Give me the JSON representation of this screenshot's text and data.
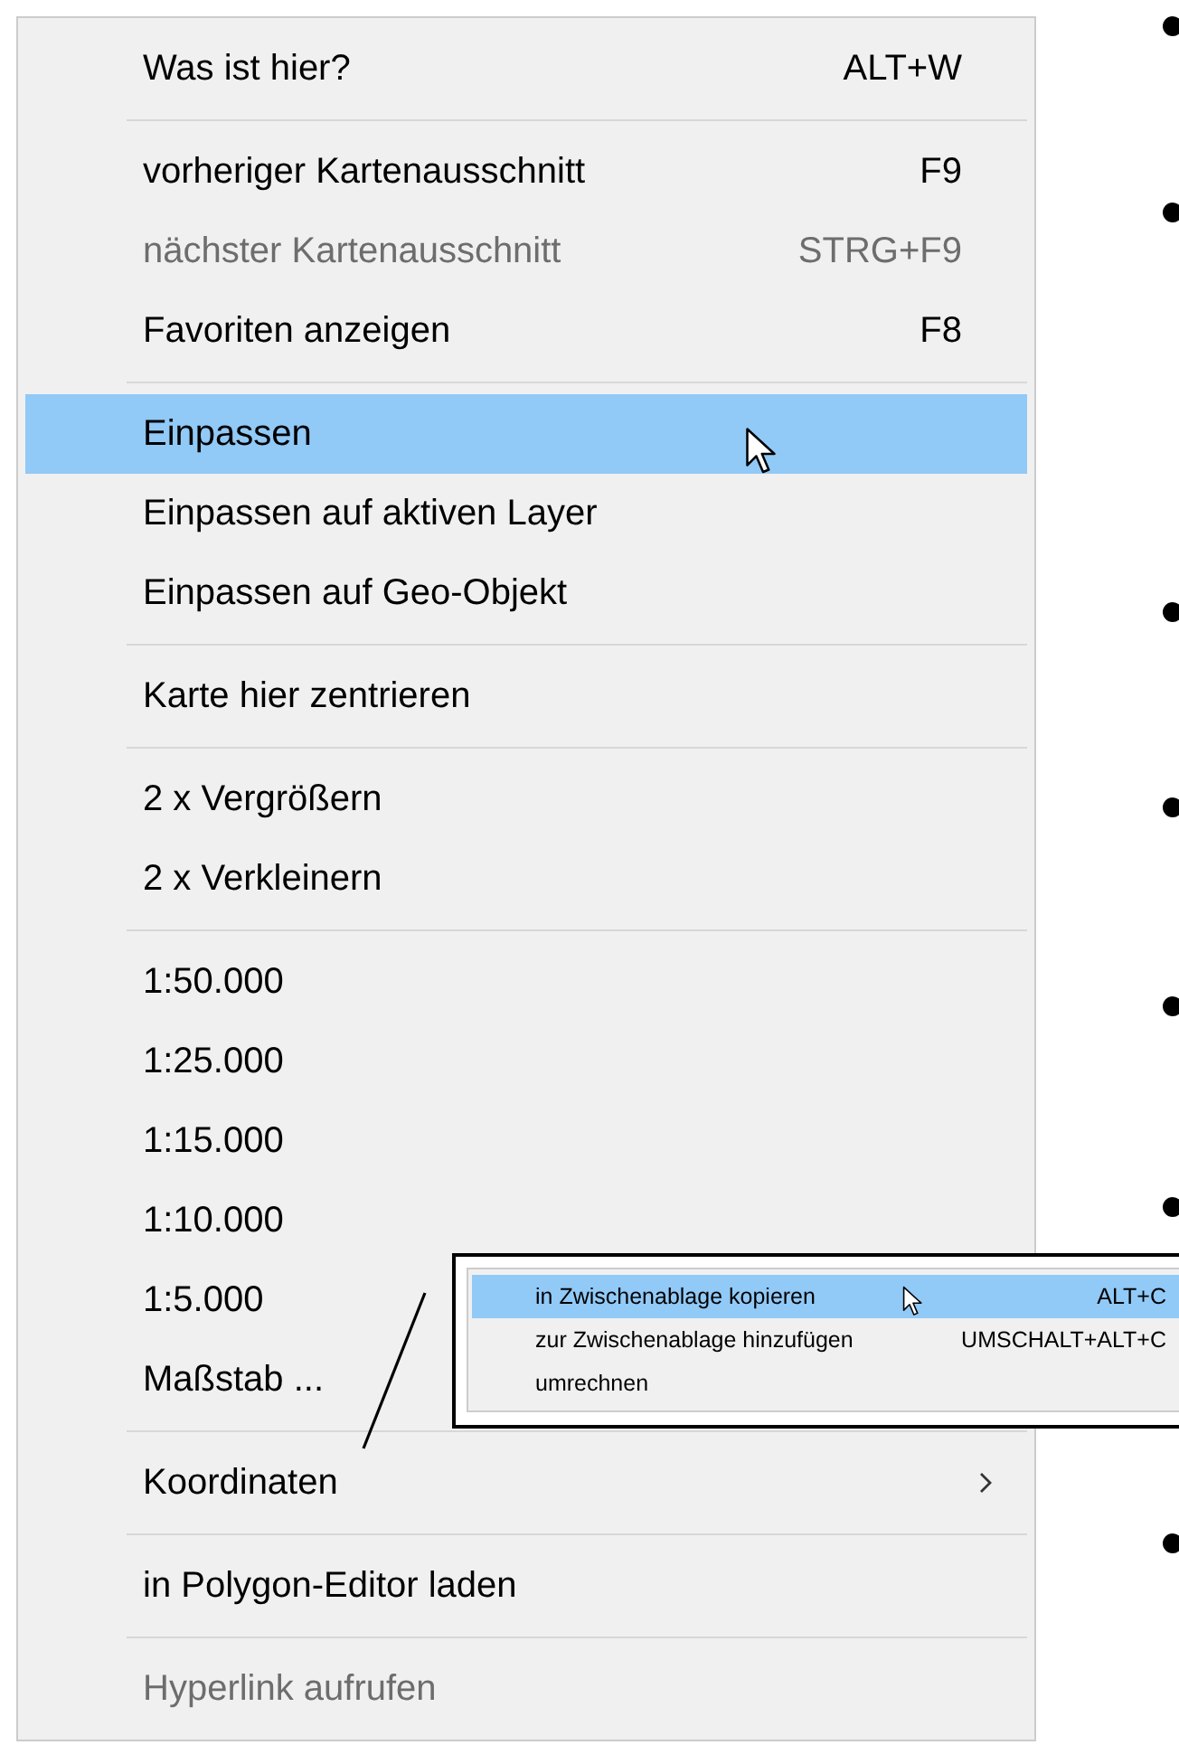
{
  "context_menu": {
    "items": [
      {
        "kind": "item",
        "label": "Was ist hier?",
        "shortcut": "ALT+W",
        "disabled": false,
        "selected": false
      },
      {
        "kind": "separator"
      },
      {
        "kind": "item",
        "label": "vorheriger Kartenausschnitt",
        "shortcut": "F9",
        "disabled": false,
        "selected": false
      },
      {
        "kind": "item",
        "label": "nächster Kartenausschnitt",
        "shortcut": "STRG+F9",
        "disabled": true,
        "selected": false
      },
      {
        "kind": "item",
        "label": "Favoriten anzeigen",
        "shortcut": "F8",
        "disabled": false,
        "selected": false
      },
      {
        "kind": "separator"
      },
      {
        "kind": "item",
        "label": "Einpassen",
        "disabled": false,
        "selected": true
      },
      {
        "kind": "item",
        "label": "Einpassen auf aktiven Layer",
        "disabled": false,
        "selected": false
      },
      {
        "kind": "item",
        "label": "Einpassen auf Geo-Objekt",
        "disabled": false,
        "selected": false
      },
      {
        "kind": "separator"
      },
      {
        "kind": "item",
        "label": "Karte hier zentrieren",
        "disabled": false,
        "selected": false
      },
      {
        "kind": "separator"
      },
      {
        "kind": "item",
        "label": "2 x Vergrößern",
        "disabled": false,
        "selected": false
      },
      {
        "kind": "item",
        "label": "2 x Verkleinern",
        "disabled": false,
        "selected": false
      },
      {
        "kind": "separator"
      },
      {
        "kind": "item",
        "label": "1:50.000",
        "disabled": false,
        "selected": false
      },
      {
        "kind": "item",
        "label": "1:25.000",
        "disabled": false,
        "selected": false
      },
      {
        "kind": "item",
        "label": "1:15.000",
        "disabled": false,
        "selected": false
      },
      {
        "kind": "item",
        "label": "1:10.000",
        "disabled": false,
        "selected": false
      },
      {
        "kind": "item",
        "label": "1:5.000",
        "disabled": false,
        "selected": false
      },
      {
        "kind": "item",
        "label": "Maßstab ...",
        "disabled": false,
        "selected": false
      },
      {
        "kind": "separator"
      },
      {
        "kind": "item",
        "label": "Koordinaten",
        "disabled": false,
        "selected": false,
        "submenu": true
      },
      {
        "kind": "separator"
      },
      {
        "kind": "item",
        "label": "in Polygon-Editor laden",
        "disabled": false,
        "selected": false
      },
      {
        "kind": "separator"
      },
      {
        "kind": "item",
        "label": "Hyperlink aufrufen",
        "disabled": true,
        "selected": false
      }
    ]
  },
  "submenu_callout": {
    "items": [
      {
        "label": "in Zwischenablage kopieren",
        "shortcut": "ALT+C",
        "selected": true
      },
      {
        "label": "zur Zwischenablage hinzufügen",
        "shortcut": "UMSCHALT+ALT+C",
        "selected": false
      },
      {
        "label": "umrechnen",
        "selected": false
      }
    ]
  }
}
